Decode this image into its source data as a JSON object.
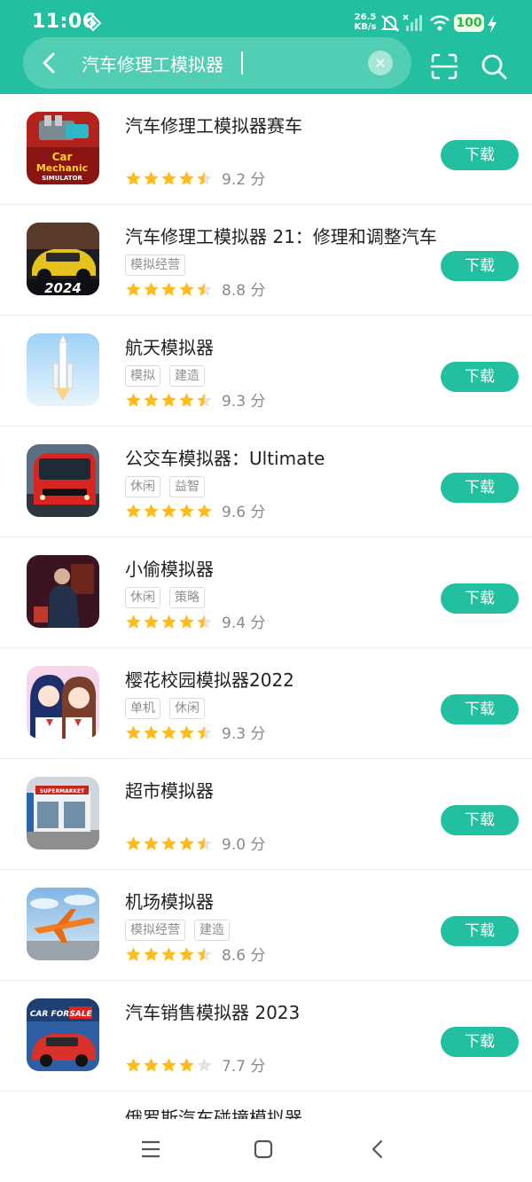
{
  "status_bar": {
    "time": "11:06",
    "net_speed_value": "26.5",
    "net_speed_unit": "KB/s",
    "battery": "100"
  },
  "search": {
    "query": "汽车修理工模拟器",
    "clear_icon": "×"
  },
  "download_label": "下载",
  "results": [
    {
      "title": "汽车修理工模拟器赛车",
      "tags": [],
      "stars": 4.5,
      "score": "9.2 分",
      "icon": "car-mechanic-icon"
    },
    {
      "title": "汽车修理工模拟器 21：修理和调整汽车",
      "tags": [
        "模拟经营"
      ],
      "stars": 4.5,
      "score": "8.8 分",
      "icon": "car-mechanic-2024-icon"
    },
    {
      "title": "航天模拟器",
      "tags": [
        "模拟",
        "建造"
      ],
      "stars": 4.5,
      "score": "9.3 分",
      "icon": "rocket-icon"
    },
    {
      "title": "公交车模拟器：Ultimate",
      "tags": [
        "休闲",
        "益智"
      ],
      "stars": 5,
      "score": "9.6 分",
      "icon": "bus-icon"
    },
    {
      "title": "小偷模拟器",
      "tags": [
        "休闲",
        "策略"
      ],
      "stars": 4.5,
      "score": "9.4 分",
      "icon": "thief-icon"
    },
    {
      "title": "樱花校园模拟器2022",
      "tags": [
        "单机",
        "休闲"
      ],
      "stars": 4.5,
      "score": "9.3 分",
      "icon": "anime-girls-icon"
    },
    {
      "title": "超市模拟器",
      "tags": [],
      "stars": 4.5,
      "score": "9.0 分",
      "icon": "supermarket-icon"
    },
    {
      "title": "机场模拟器",
      "tags": [
        "模拟经营",
        "建造"
      ],
      "stars": 4.5,
      "score": "8.6 分",
      "icon": "airplane-icon"
    },
    {
      "title": "汽车销售模拟器 2023",
      "tags": [],
      "stars": 4,
      "score": "7.7 分",
      "icon": "car-for-sale-icon"
    },
    {
      "title": "俄罗斯汽车碰撞模拟器",
      "tags": [],
      "stars": null,
      "score": "",
      "icon": "crash-car-icon"
    }
  ],
  "icon_texts": {
    "car_mechanic": [
      "Car",
      "Mechanic",
      "SIMULATOR"
    ],
    "year_2024": "2024",
    "supermarket": "SUPERMARKET",
    "car_for_sale": [
      "CAR FOR",
      "SALE"
    ]
  },
  "colors": {
    "accent": "#22c0a0",
    "star": "#ffbb1c",
    "star_empty": "#e3e3e3"
  }
}
